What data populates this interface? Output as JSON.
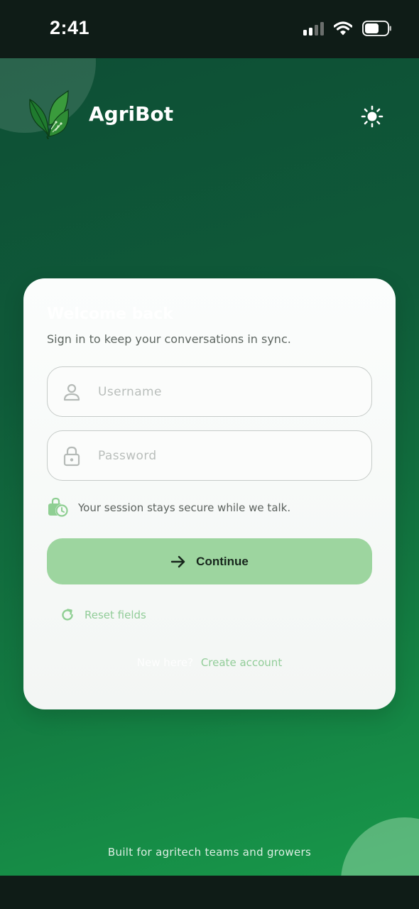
{
  "status_bar": {
    "time": "2:41",
    "signal_icon": "cellular-signal-icon",
    "wifi_icon": "wifi-icon",
    "battery_icon": "battery-icon"
  },
  "header": {
    "app_name": "AgriBot",
    "logo_icon": "leaf-circuit-logo",
    "theme_icon": "sun-icon"
  },
  "login_card": {
    "title": "Welcome back",
    "subtitle": "Sign in to keep your conversations in sync.",
    "username": {
      "placeholder": "Username",
      "value": "",
      "icon": "user-icon"
    },
    "password": {
      "placeholder": "Password",
      "value": "",
      "icon": "lock-icon"
    },
    "security_note": "Your session stays secure while we talk.",
    "security_icon": "secure-session-icon",
    "continue_label": "Continue",
    "continue_icon": "arrow-right-icon",
    "reset_label": "Reset fields",
    "reset_icon": "refresh-icon",
    "signup_prompt": "New here?",
    "signup_link": "Create account"
  },
  "footer": {
    "text": "Built for agritech teams and growers"
  },
  "colors": {
    "background_top": "#0e4f35",
    "background_bottom": "#18984a",
    "accent": "#9dd59f",
    "link": "#92cd99"
  }
}
